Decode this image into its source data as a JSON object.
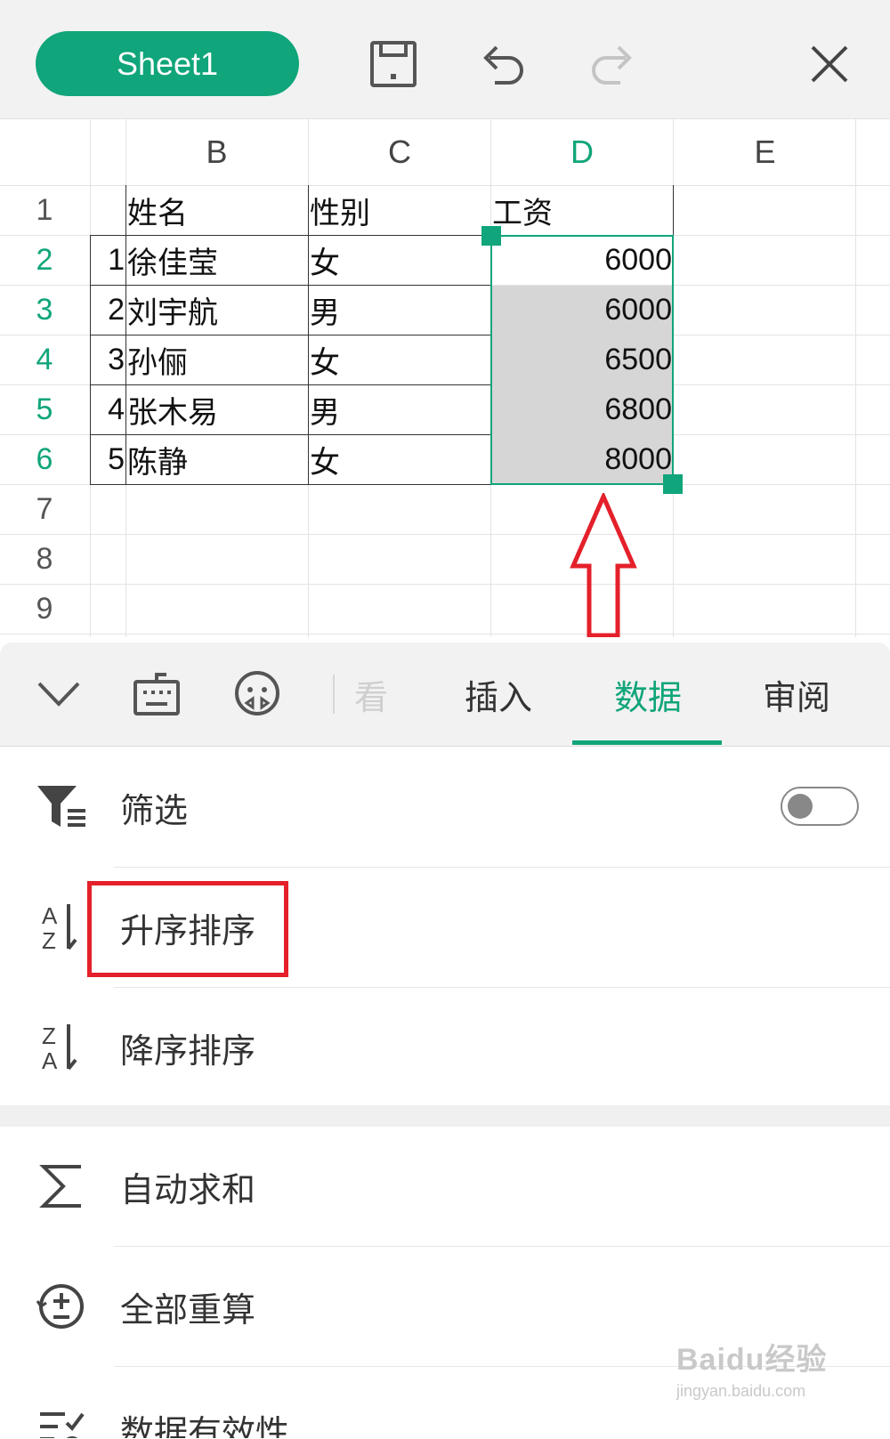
{
  "toolbar": {
    "sheet_name": "Sheet1",
    "icons": [
      "save-icon",
      "undo-icon",
      "redo-icon",
      "close-icon"
    ]
  },
  "grid": {
    "columns": [
      "B",
      "C",
      "D",
      "E"
    ],
    "active_column": "D",
    "row_numbers": [
      "1",
      "2",
      "3",
      "4",
      "5",
      "6",
      "7",
      "8",
      "9"
    ],
    "active_rows": [
      "2",
      "3",
      "4",
      "5",
      "6"
    ],
    "header_row": {
      "b": "姓名",
      "c": "性别",
      "d": "工资"
    },
    "rows": [
      {
        "a": "1",
        "b": "徐佳莹",
        "c": "女",
        "d": "6000"
      },
      {
        "a": "2",
        "b": "刘宇航",
        "c": "男",
        "d": "6000"
      },
      {
        "a": "3",
        "b": "孙俪",
        "c": "女",
        "d": "6500"
      },
      {
        "a": "4",
        "b": "张木易",
        "c": "男",
        "d": "6800"
      },
      {
        "a": "5",
        "b": "陈静",
        "c": "女",
        "d": "8000"
      }
    ],
    "selection_color": "#10a57a",
    "selection_fill": "#d6d6d6"
  },
  "tabs": {
    "partial_label": "看",
    "items": [
      "插入",
      "数据",
      "审阅"
    ],
    "active": "数据",
    "icons": [
      "chevron-down-icon",
      "keyboard-icon",
      "face-icon"
    ]
  },
  "menu": {
    "filter": "筛选",
    "filter_toggle": false,
    "sort_asc": "升序排序",
    "sort_desc": "降序排序",
    "autosum": "自动求和",
    "recalc": "全部重算",
    "validation": "数据有效性"
  },
  "annotation": {
    "highlight_color": "#e4202a"
  },
  "watermark": {
    "line1": "Baidu经验",
    "line2": "jingyan.baidu.com"
  },
  "colors": {
    "accent": "#10a57a"
  }
}
